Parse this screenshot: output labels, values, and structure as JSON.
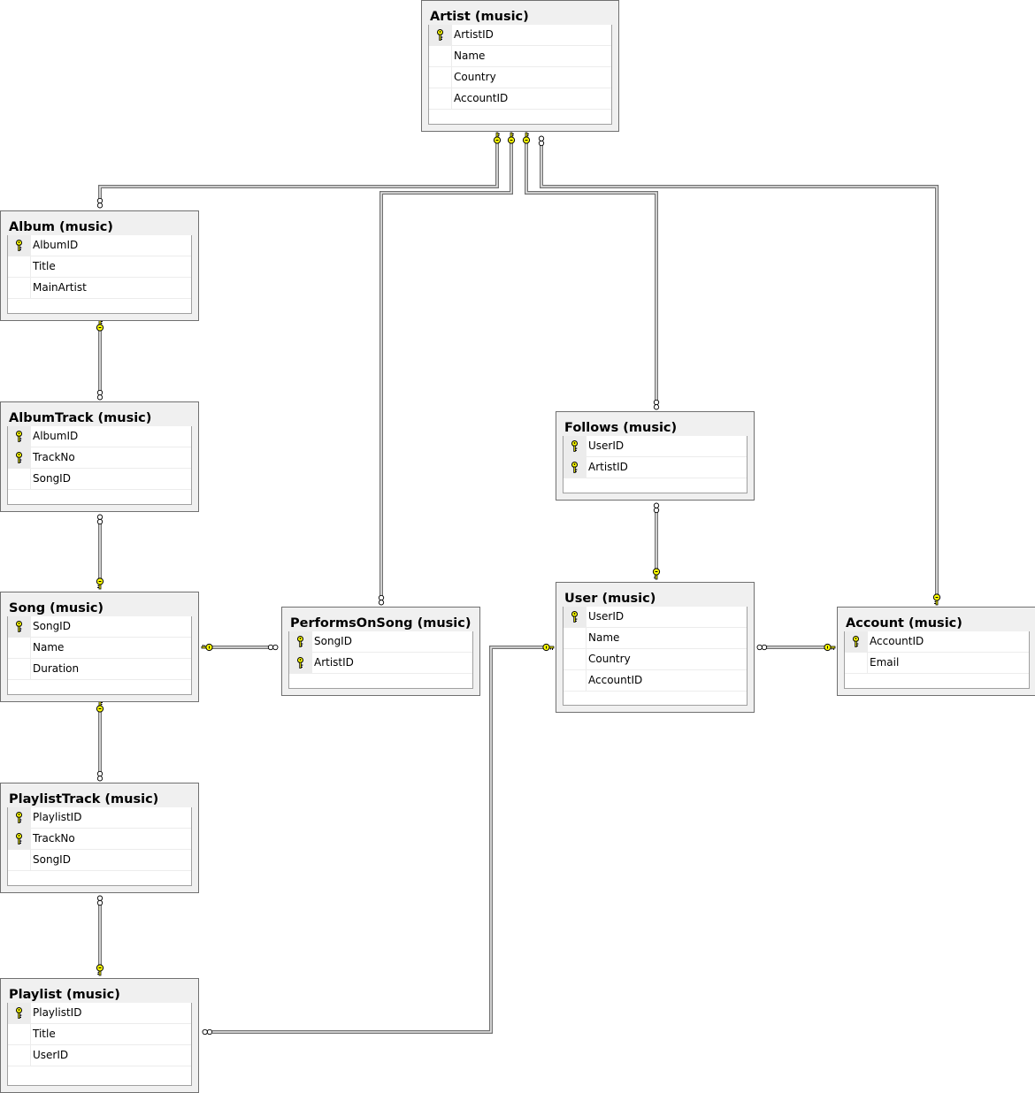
{
  "diagram": {
    "schema": "music",
    "tables": [
      {
        "id": "artist",
        "title": "Artist (music)",
        "columns": [
          {
            "name": "ArtistID",
            "pk": true
          },
          {
            "name": "Name",
            "pk": false
          },
          {
            "name": "Country",
            "pk": false
          },
          {
            "name": "AccountID",
            "pk": false
          }
        ]
      },
      {
        "id": "album",
        "title": "Album (music)",
        "columns": [
          {
            "name": "AlbumID",
            "pk": true
          },
          {
            "name": "Title",
            "pk": false
          },
          {
            "name": "MainArtist",
            "pk": false
          }
        ]
      },
      {
        "id": "albumtrack",
        "title": "AlbumTrack (music)",
        "columns": [
          {
            "name": "AlbumID",
            "pk": true
          },
          {
            "name": "TrackNo",
            "pk": true
          },
          {
            "name": "SongID",
            "pk": false
          }
        ]
      },
      {
        "id": "song",
        "title": "Song (music)",
        "columns": [
          {
            "name": "SongID",
            "pk": true
          },
          {
            "name": "Name",
            "pk": false
          },
          {
            "name": "Duration",
            "pk": false
          }
        ]
      },
      {
        "id": "performsonsong",
        "title": "PerformsOnSong (music)",
        "columns": [
          {
            "name": "SongID",
            "pk": true
          },
          {
            "name": "ArtistID",
            "pk": true
          }
        ]
      },
      {
        "id": "follows",
        "title": "Follows (music)",
        "columns": [
          {
            "name": "UserID",
            "pk": true
          },
          {
            "name": "ArtistID",
            "pk": true
          }
        ]
      },
      {
        "id": "user",
        "title": "User (music)",
        "columns": [
          {
            "name": "UserID",
            "pk": true
          },
          {
            "name": "Name",
            "pk": false
          },
          {
            "name": "Country",
            "pk": false
          },
          {
            "name": "AccountID",
            "pk": false
          }
        ]
      },
      {
        "id": "account",
        "title": "Account (music)",
        "columns": [
          {
            "name": "AccountID",
            "pk": true
          },
          {
            "name": "Email",
            "pk": false
          }
        ]
      },
      {
        "id": "playlisttrack",
        "title": "PlaylistTrack (music)",
        "columns": [
          {
            "name": "PlaylistID",
            "pk": true
          },
          {
            "name": "TrackNo",
            "pk": true
          },
          {
            "name": "SongID",
            "pk": false
          }
        ]
      },
      {
        "id": "playlist",
        "title": "Playlist (music)",
        "columns": [
          {
            "name": "PlaylistID",
            "pk": true
          },
          {
            "name": "Title",
            "pk": false
          },
          {
            "name": "UserID",
            "pk": false
          }
        ]
      }
    ],
    "relationships": [
      {
        "from": "album",
        "to": "artist",
        "one_end": "artist",
        "many_end": "album"
      },
      {
        "from": "performsonsong",
        "to": "artist",
        "one_end": "artist",
        "many_end": "performsonsong"
      },
      {
        "from": "follows",
        "to": "artist",
        "one_end": "artist",
        "many_end": "follows"
      },
      {
        "from": "artist",
        "to": "account",
        "one_end": "account",
        "many_end": "artist"
      },
      {
        "from": "albumtrack",
        "to": "album",
        "one_end": "album",
        "many_end": "albumtrack"
      },
      {
        "from": "albumtrack",
        "to": "song",
        "one_end": "song",
        "many_end": "albumtrack"
      },
      {
        "from": "performsonsong",
        "to": "song",
        "one_end": "song",
        "many_end": "performsonsong"
      },
      {
        "from": "playlisttrack",
        "to": "song",
        "one_end": "song",
        "many_end": "playlisttrack"
      },
      {
        "from": "playlisttrack",
        "to": "playlist",
        "one_end": "playlist",
        "many_end": "playlisttrack"
      },
      {
        "from": "follows",
        "to": "user",
        "one_end": "user",
        "many_end": "follows"
      },
      {
        "from": "user",
        "to": "account",
        "one_end": "account",
        "many_end": "user"
      },
      {
        "from": "playlist",
        "to": "user",
        "one_end": "user",
        "many_end": "playlist"
      }
    ],
    "colors": {
      "key": "#ffff00",
      "line": "#808080",
      "header": "#f0f0f0"
    }
  }
}
